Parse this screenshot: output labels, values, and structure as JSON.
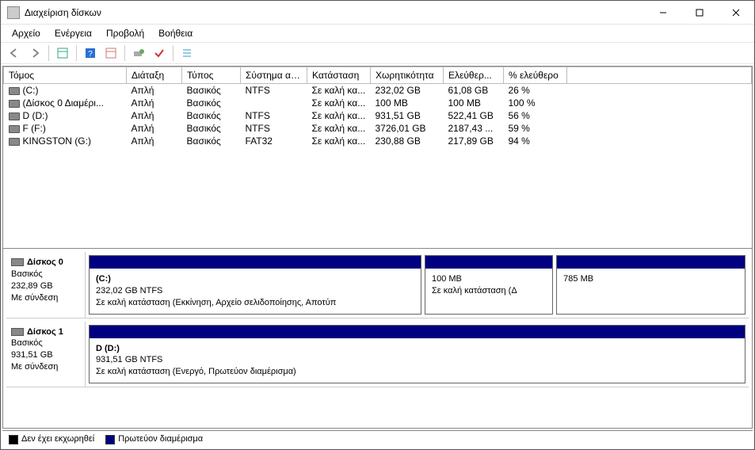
{
  "window": {
    "title": "Διαχείριση δίσκων"
  },
  "menu": {
    "file": "Αρχείο",
    "action": "Ενέργεια",
    "view": "Προβολή",
    "help": "Βοήθεια"
  },
  "columns": {
    "volume": "Τόμος",
    "layout": "Διάταξη",
    "type": "Τύπος",
    "fs": "Σύστημα αρ...",
    "status": "Κατάσταση",
    "capacity": "Χωρητικότητα",
    "free": "Ελεύθερ...",
    "pctfree": "% ελεύθερο"
  },
  "volumes": [
    {
      "name": "(C:)",
      "layout": "Απλή",
      "type": "Βασικός",
      "fs": "NTFS",
      "status": "Σε καλή κα...",
      "capacity": "232,02 GB",
      "free": "61,08 GB",
      "pctfree": "26 %"
    },
    {
      "name": "(Δίσκος 0 Διαμέρι...",
      "layout": "Απλή",
      "type": "Βασικός",
      "fs": "",
      "status": "Σε καλή κα...",
      "capacity": "100 MB",
      "free": "100 MB",
      "pctfree": "100 %"
    },
    {
      "name": "D (D:)",
      "layout": "Απλή",
      "type": "Βασικός",
      "fs": "NTFS",
      "status": "Σε καλή κα...",
      "capacity": "931,51 GB",
      "free": "522,41 GB",
      "pctfree": "56 %"
    },
    {
      "name": "F (F:)",
      "layout": "Απλή",
      "type": "Βασικός",
      "fs": "NTFS",
      "status": "Σε καλή κα...",
      "capacity": "3726,01 GB",
      "free": "2187,43 ...",
      "pctfree": "59 %"
    },
    {
      "name": "KINGSTON (G:)",
      "layout": "Απλή",
      "type": "Βασικός",
      "fs": "FAT32",
      "status": "Σε καλή κα...",
      "capacity": "230,88 GB",
      "free": "217,89 GB",
      "pctfree": "94 %"
    }
  ],
  "disks": [
    {
      "name": "Δίσκος 0",
      "type": "Βασικός",
      "size": "232,89 GB",
      "status": "Με σύνδεση",
      "partitions": [
        {
          "title": "(C:)",
          "sub": "232,02 GB NTFS",
          "status": "Σε καλή κατάσταση (Εκκίνηση, Αρχείο σελιδοποίησης, Αποτύπ",
          "flex": 6
        },
        {
          "title": "",
          "sub": "100 MB",
          "status": "Σε καλή κατάσταση (Δ",
          "flex": 2.3
        },
        {
          "title": "",
          "sub": "785 MB",
          "status": "",
          "flex": 3.4
        }
      ]
    },
    {
      "name": "Δίσκος 1",
      "type": "Βασικός",
      "size": "931,51 GB",
      "status": "Με σύνδεση",
      "partitions": [
        {
          "title": "D  (D:)",
          "sub": "931,51 GB NTFS",
          "status": "Σε καλή κατάσταση (Ενεργό, Πρωτεύον διαμέρισμα)",
          "flex": 1
        }
      ]
    }
  ],
  "legend": {
    "unalloc": "Δεν έχει εκχωρηθεί",
    "primary": "Πρωτεύον διαμέρισμα"
  }
}
